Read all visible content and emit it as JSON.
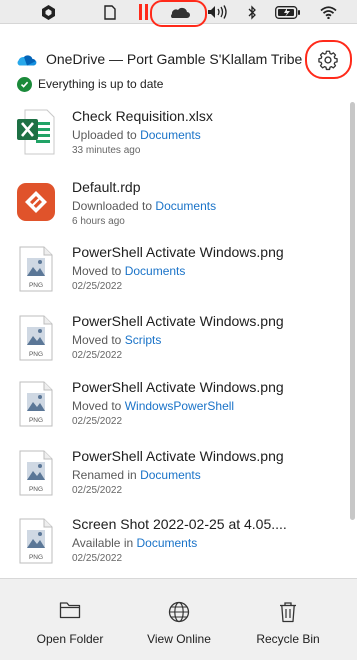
{
  "header": {
    "title": "OneDrive — Port Gamble S'Klallam Tribe",
    "status": "Everything is up to date"
  },
  "files": [
    {
      "name": "Check Requisition.xlsx",
      "action": "Uploaded to",
      "folder": "Documents",
      "time": "33 minutes ago",
      "icon": "excel-icon"
    },
    {
      "name": "Default.rdp",
      "action": "Downloaded to",
      "folder": "Documents",
      "time": "6 hours ago",
      "icon": "remote-desktop-icon"
    },
    {
      "name": "PowerShell Activate Windows.png",
      "action": "Moved to",
      "folder": "Documents",
      "time": "02/25/2022",
      "icon": "png-file-icon"
    },
    {
      "name": "PowerShell Activate Windows.png",
      "action": "Moved to",
      "folder": "Scripts",
      "time": "02/25/2022",
      "icon": "png-file-icon"
    },
    {
      "name": "PowerShell Activate Windows.png",
      "action": "Moved to",
      "folder": "WindowsPowerShell",
      "time": "02/25/2022",
      "icon": "png-file-icon"
    },
    {
      "name": "PowerShell Activate Windows.png",
      "action": "Renamed in",
      "folder": "Documents",
      "time": "02/25/2022",
      "icon": "png-file-icon"
    },
    {
      "name": "Screen Shot 2022-02-25 at 4.05....",
      "action": "Available in",
      "folder": "Documents",
      "time": "02/25/2022",
      "icon": "png-file-icon"
    }
  ],
  "png_label": "PNG",
  "footer": {
    "open_folder": "Open Folder",
    "view_online": "View Online",
    "recycle_bin": "Recycle Bin"
  },
  "colors": {
    "link": "#1a73c8",
    "status_green": "#1b8a3a",
    "annotation_red": "#ff2a1a",
    "excel_green": "#1d7044",
    "rdp_orange": "#e0532b"
  }
}
